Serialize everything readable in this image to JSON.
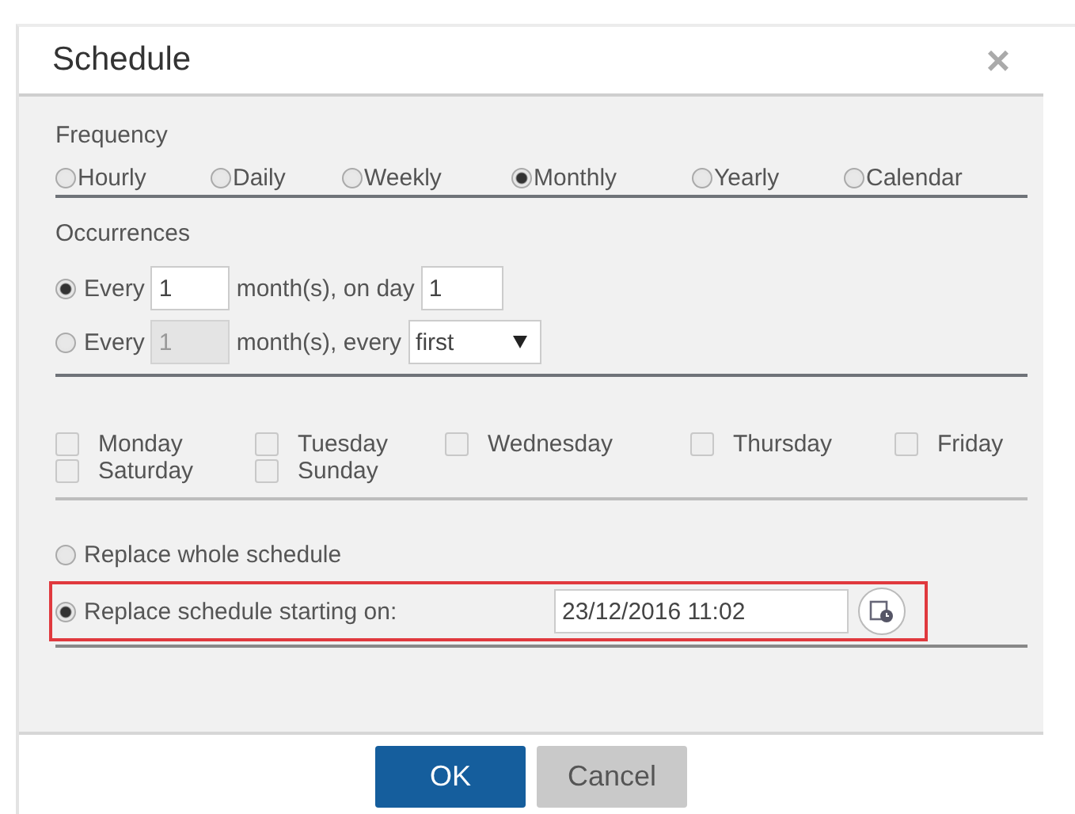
{
  "dialog": {
    "title": "Schedule",
    "close": "×"
  },
  "frequency": {
    "label": "Frequency",
    "options": [
      {
        "label": "Hourly",
        "selected": false
      },
      {
        "label": "Daily",
        "selected": false
      },
      {
        "label": "Weekly",
        "selected": false
      },
      {
        "label": "Monthly",
        "selected": true
      },
      {
        "label": "Yearly",
        "selected": false
      },
      {
        "label": "Calendar",
        "selected": false
      }
    ]
  },
  "occurrences": {
    "label": "Occurrences",
    "rows": [
      {
        "kind": "day",
        "selected": true,
        "prefix": "Every",
        "count": "1",
        "count_disabled": false,
        "middle": "month(s), on day",
        "value": "1"
      },
      {
        "kind": "weekday",
        "selected": false,
        "prefix": "Every",
        "count": "1",
        "count_disabled": true,
        "middle": "month(s), every",
        "value": "first"
      }
    ]
  },
  "weekdays": [
    {
      "label": "Monday",
      "checked": false
    },
    {
      "label": "Tuesday",
      "checked": false
    },
    {
      "label": "Wednesday",
      "checked": false
    },
    {
      "label": "Thursday",
      "checked": false
    },
    {
      "label": "Friday",
      "checked": false
    },
    {
      "label": "Saturday",
      "checked": false
    },
    {
      "label": "Sunday",
      "checked": false
    }
  ],
  "replace": [
    {
      "kind": "plain",
      "label": "Replace whole schedule",
      "selected": false
    },
    {
      "kind": "date",
      "label": "Replace schedule starting on:",
      "selected": true,
      "value": "23/12/2016 11:02"
    }
  ],
  "buttons": [
    {
      "label": "OK",
      "kind": "primary"
    },
    {
      "label": "Cancel",
      "kind": "secondary"
    }
  ]
}
